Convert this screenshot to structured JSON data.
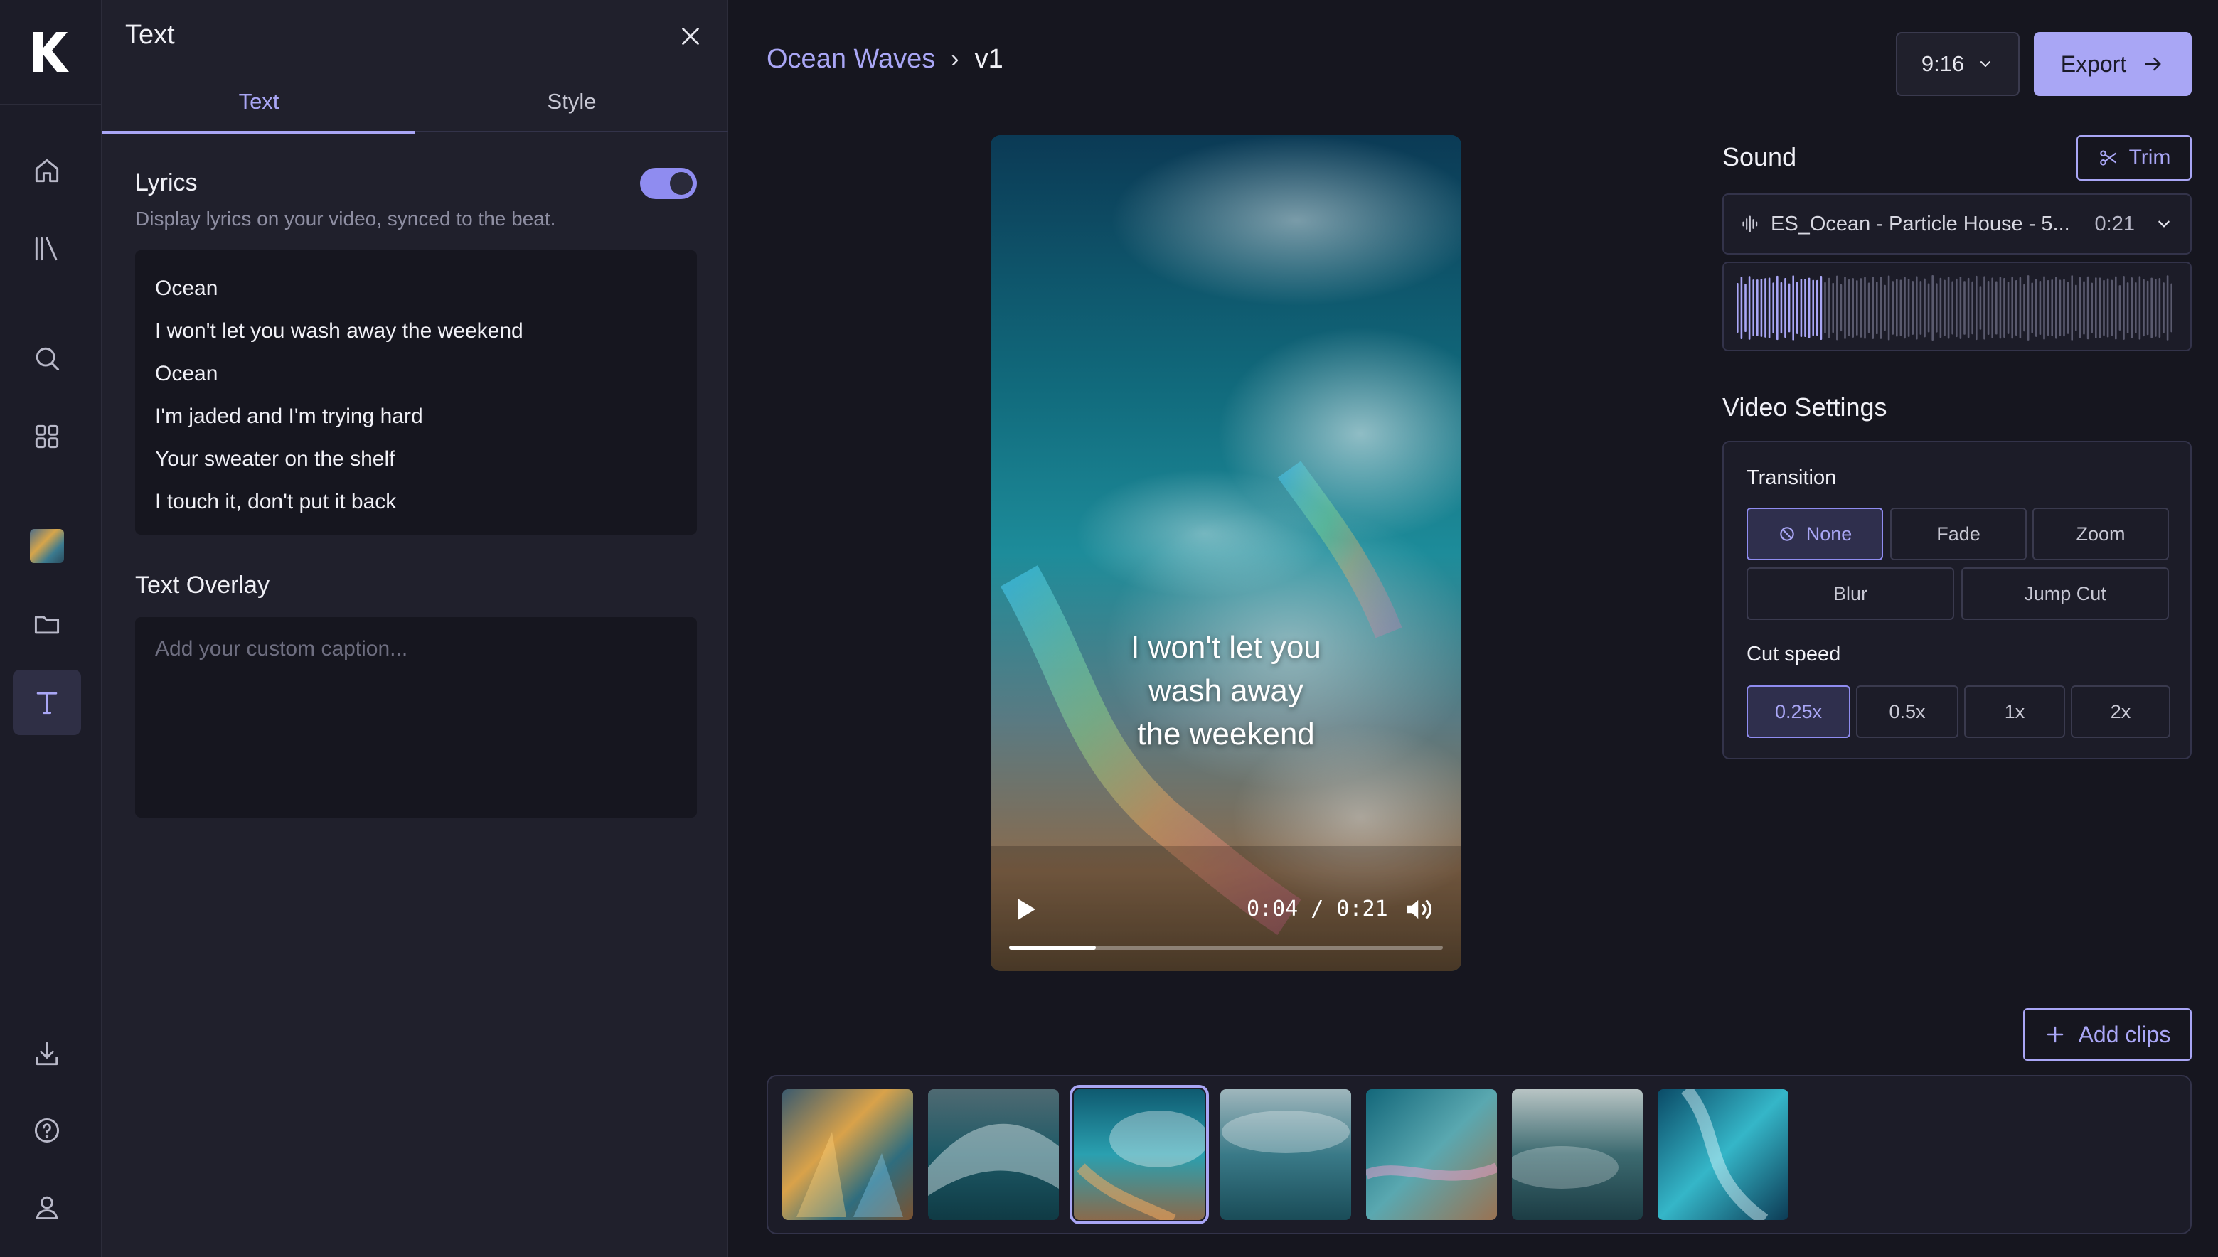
{
  "panel": {
    "title": "Text",
    "tabs": [
      {
        "label": "Text",
        "active": true
      },
      {
        "label": "Style",
        "active": false
      }
    ],
    "lyrics": {
      "label": "Lyrics",
      "description": "Display lyrics on your video, synced to the beat.",
      "enabled": true,
      "lines": [
        "Ocean",
        "I won't let you wash away the weekend",
        "Ocean",
        "I'm jaded and I'm trying hard",
        "Your sweater on the shelf",
        "I touch it, don't put it back"
      ]
    },
    "overlay": {
      "label": "Text Overlay",
      "placeholder": "Add your custom caption..."
    }
  },
  "header": {
    "project": "Ocean Waves",
    "version": "v1",
    "aspect_ratio": "9:16",
    "export_label": "Export"
  },
  "preview": {
    "caption_lines": [
      "I won't let you",
      "wash away",
      "the weekend"
    ],
    "time": "0:04 / 0:21",
    "progress": 0.2
  },
  "sound": {
    "title": "Sound",
    "trim_label": "Trim",
    "track": "ES_Ocean - Particle House - 5...",
    "duration": "0:21"
  },
  "video_settings": {
    "title": "Video Settings",
    "transition_label": "Transition",
    "transitions": [
      {
        "label": "None",
        "selected": true
      },
      {
        "label": "Fade",
        "selected": false
      },
      {
        "label": "Zoom",
        "selected": false
      },
      {
        "label": "Blur",
        "selected": false
      },
      {
        "label": "Jump Cut",
        "selected": false
      }
    ],
    "cut_speed_label": "Cut speed",
    "cut_speeds": [
      {
        "label": "0.25x",
        "selected": true
      },
      {
        "label": "0.5x",
        "selected": false
      },
      {
        "label": "1x",
        "selected": false
      },
      {
        "label": "2x",
        "selected": false
      }
    ]
  },
  "timeline": {
    "add_clips_label": "Add clips",
    "selected_clip": 3
  },
  "colors": {
    "accent": "#a9a6f5",
    "background": "#16161f",
    "panel": "#20202c"
  },
  "rail_icons": [
    "logo-icon",
    "home-icon",
    "library-icon",
    "search-icon",
    "apps-grid-icon",
    "media-thumbnail",
    "folder-icon",
    "text-tool-icon",
    "download-icon",
    "help-icon",
    "account-icon"
  ]
}
